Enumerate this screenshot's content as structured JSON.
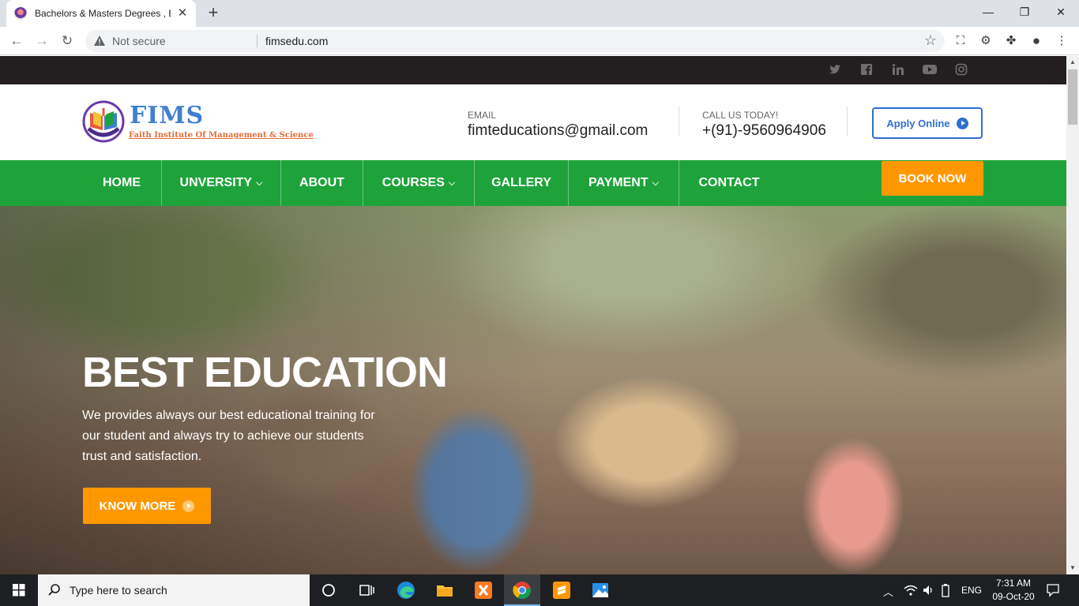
{
  "browser": {
    "tab_title": "Bachelors & Masters Degrees , B",
    "security_label": "Not secure",
    "url": "fimsedu.com"
  },
  "site": {
    "logo_text": "FIMS",
    "logo_tagline": "Faith Institute Of Management & Science",
    "email_label": "EMAIL",
    "email_value": "fimteducations@gmail.com",
    "phone_label": "CALL US TODAY!",
    "phone_value": "+(91)-9560964906",
    "apply_label": "Apply Online",
    "nav": [
      {
        "label": "HOME",
        "has_dropdown": false
      },
      {
        "label": "UNVERSITY",
        "has_dropdown": true
      },
      {
        "label": "ABOUT",
        "has_dropdown": false
      },
      {
        "label": "COURSES",
        "has_dropdown": true
      },
      {
        "label": "GALLERY",
        "has_dropdown": false
      },
      {
        "label": "PAYMENT",
        "has_dropdown": true
      },
      {
        "label": "CONTACT",
        "has_dropdown": false
      }
    ],
    "book_label": "BOOK NOW",
    "hero": {
      "title": "BEST EDUCATION",
      "text": "We provides always our best educational training for our student and always try to achieve our students trust and satisfaction.",
      "button": "KNOW MORE"
    },
    "social": [
      "twitter-icon",
      "facebook-icon",
      "linkedin-icon",
      "youtube-icon",
      "instagram-icon"
    ]
  },
  "taskbar": {
    "search_placeholder": "Type here to search",
    "lang": "ENG",
    "time": "7:31 AM",
    "date": "09-Oct-20"
  },
  "colors": {
    "nav_green": "#1ea33b",
    "accent_orange": "#ff9800",
    "top_bar": "#231f20",
    "apply_blue": "#2f6fd1"
  }
}
